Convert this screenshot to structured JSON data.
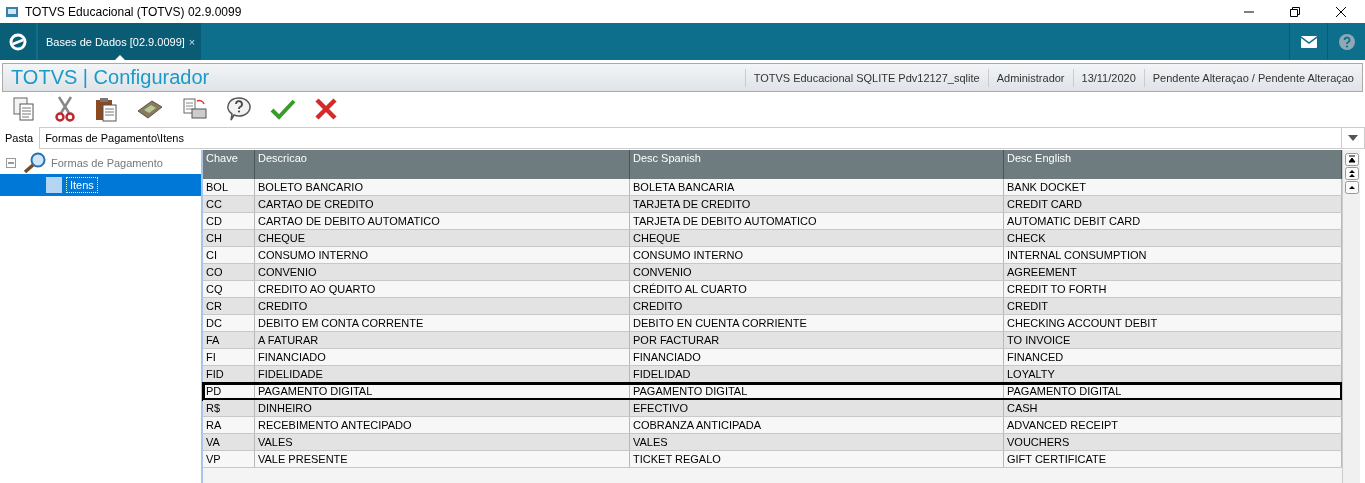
{
  "window": {
    "title": "TOTVS Educacional (TOTVS) 02.9.0099"
  },
  "tabs": [
    {
      "label": "Bases de Dados [02.9.0099]",
      "selected": true,
      "close": "×"
    }
  ],
  "header": {
    "title": "TOTVS | Configurador",
    "info": [
      "TOTVS Educacional SQLITE Pdv12127_sqlite",
      "Administrador",
      "13/11/2020",
      "Pendente Alteraçao / Pendente Alteraçao"
    ]
  },
  "folder": {
    "label": "Pasta",
    "value": "Formas de Pagamento\\Itens"
  },
  "tree": [
    {
      "label": "Formas de Pagamento",
      "expanded": true,
      "selected": false,
      "children": [
        {
          "label": "Itens",
          "selected": true
        }
      ]
    }
  ],
  "table": {
    "columns": [
      "Chave",
      "Descricao",
      "Desc Spanish",
      "Desc English"
    ],
    "rows": [
      {
        "cells": [
          "BOL",
          "BOLETO BANCARIO",
          "BOLETA BANCARIA",
          "BANK DOCKET"
        ],
        "highlighted": false
      },
      {
        "cells": [
          "CC",
          "CARTAO DE CREDITO",
          "TARJETA DE CREDITO",
          "CREDIT CARD"
        ],
        "highlighted": false
      },
      {
        "cells": [
          "CD",
          "CARTAO DE DEBITO AUTOMATICO",
          "TARJETA DE DEBITO AUTOMATICO",
          "AUTOMATIC DEBIT CARD"
        ],
        "highlighted": false
      },
      {
        "cells": [
          "CH",
          "CHEQUE",
          "CHEQUE",
          "CHECK"
        ],
        "highlighted": false
      },
      {
        "cells": [
          "CI",
          "CONSUMO INTERNO",
          "CONSUMO INTERNO",
          "INTERNAL CONSUMPTION"
        ],
        "highlighted": false
      },
      {
        "cells": [
          "CO",
          "CONVENIO",
          "CONVENIO",
          "AGREEMENT"
        ],
        "highlighted": false
      },
      {
        "cells": [
          "CQ",
          "CREDITO AO QUARTO",
          "CRÉDITO AL CUARTO",
          "CREDIT TO FORTH"
        ],
        "highlighted": false
      },
      {
        "cells": [
          "CR",
          "CREDITO",
          "CREDITO",
          "CREDIT"
        ],
        "highlighted": false
      },
      {
        "cells": [
          "DC",
          "DEBITO EM CONTA CORRENTE",
          "DEBITO EN CUENTA CORRIENTE",
          "CHECKING ACCOUNT DEBIT"
        ],
        "highlighted": false
      },
      {
        "cells": [
          "FA",
          "A FATURAR",
          "POR FACTURAR",
          "TO INVOICE"
        ],
        "highlighted": false
      },
      {
        "cells": [
          "FI",
          "FINANCIADO",
          "FINANCIADO",
          "FINANCED"
        ],
        "highlighted": false
      },
      {
        "cells": [
          "FID",
          "FIDELIDADE",
          "FIDELIDAD",
          "LOYALTY"
        ],
        "highlighted": false
      },
      {
        "cells": [
          "PD",
          "PAGAMENTO DIGITAL",
          "PAGAMENTO DIGITAL",
          "PAGAMENTO DIGITAL"
        ],
        "highlighted": true
      },
      {
        "cells": [
          "R$",
          "DINHEIRO",
          "EFECTIVO",
          "CASH"
        ],
        "highlighted": false
      },
      {
        "cells": [
          "RA",
          "RECEBIMENTO ANTECIPADO",
          "COBRANZA ANTICIPADA",
          "ADVANCED RECEIPT"
        ],
        "highlighted": false
      },
      {
        "cells": [
          "VA",
          "VALES",
          "VALES",
          "VOUCHERS"
        ],
        "highlighted": false
      },
      {
        "cells": [
          "VP",
          "VALE PRESENTE",
          "TICKET REGALO",
          "GIFT CERTIFICATE"
        ],
        "highlighted": false
      }
    ]
  }
}
